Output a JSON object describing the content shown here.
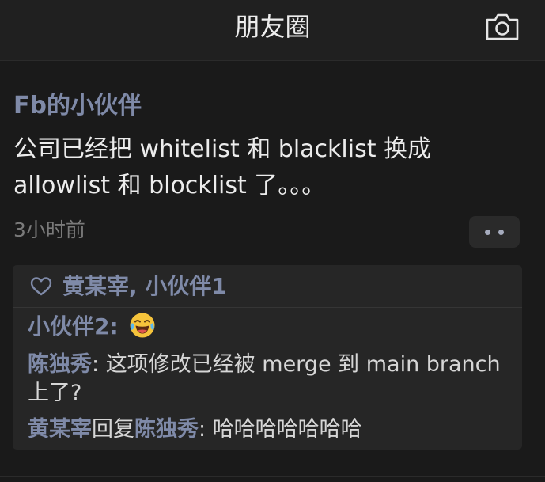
{
  "nav": {
    "title": "朋友圈",
    "camera_icon": "camera-icon"
  },
  "post": {
    "author": "Fb的小伙伴",
    "text_line1": "公司已经把 whitelist 和 blacklist 换成",
    "text_line2": "allowlist 和 blocklist 了。。。",
    "time": "3小时前",
    "more_icon": "more-dots-icon"
  },
  "likes": {
    "icon": "heart-icon",
    "names": "黄某宰, 小伙伴1"
  },
  "comments": [
    {
      "author": "小伙伴2",
      "separator": ": ",
      "emoji": "tears-of-joy-emoji"
    },
    {
      "author": "陈独秀",
      "separator": ": ",
      "text": "这项修改已经被 merge 到 main branch 上了?"
    },
    {
      "author": "黄某宰",
      "reply_word": "回复",
      "reply_to": "陈独秀",
      "separator": ": ",
      "text": "哈哈哈哈哈哈哈"
    }
  ],
  "colors": {
    "background": "#1a1a1a",
    "nav_bg": "#202020",
    "name_blue": "#7f8aa8",
    "text": "#ececec",
    "muted": "#7a7a7a",
    "comment_bg": "#262626"
  }
}
